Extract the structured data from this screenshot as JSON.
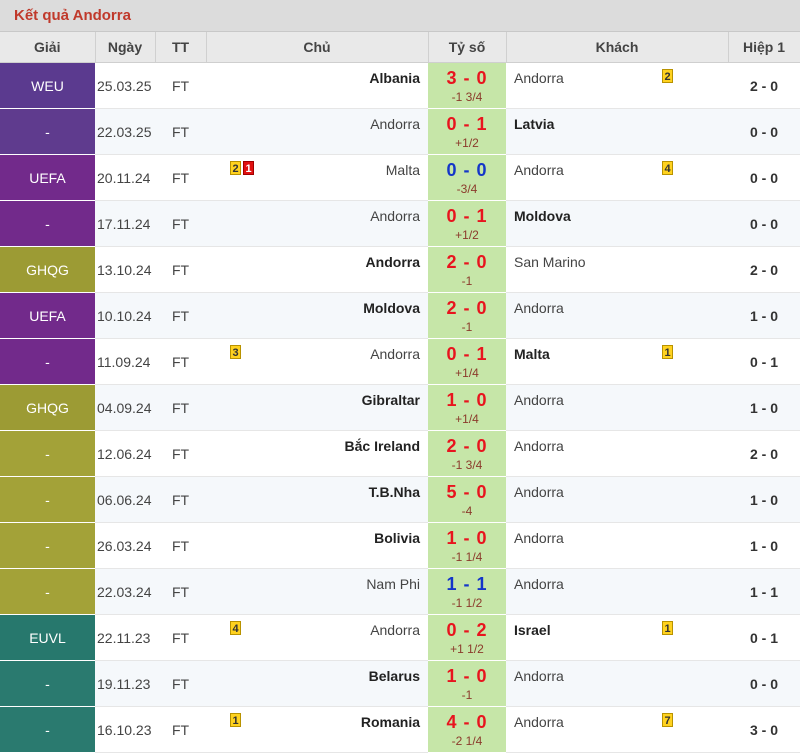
{
  "panel": {
    "title": "Kết quả Andorra"
  },
  "headers": {
    "league": "Giải",
    "date": "Ngày",
    "status": "TT",
    "home": "Chủ",
    "score": "Tỷ số",
    "away": "Khách",
    "ht": "Hiệp 1"
  },
  "league_colors": {
    "WEU": "#5b3a8f",
    "-purple": "#6a3a92",
    "UEFA": "#6f2b8a",
    "GHQG": "#9a9a2f",
    "-olive": "#a3a238",
    "EUVL": "#27786d"
  },
  "matches": [
    {
      "league": "WEU",
      "league_color": "#5b3a8f",
      "date": "25.03.25",
      "status": "FT",
      "home": "Albania",
      "home_bold": true,
      "home_cards": [],
      "score": "3 - 0",
      "score_type": "win",
      "handicap": "-1 3/4",
      "away": "Andorra",
      "away_bold": false,
      "away_cards": [
        {
          "n": "2",
          "c": "yellow"
        }
      ],
      "ht": "2 - 0"
    },
    {
      "league": "-",
      "league_color": "#5f3b8e",
      "date": "22.03.25",
      "status": "FT",
      "home": "Andorra",
      "home_bold": false,
      "home_cards": [],
      "score": "0 - 1",
      "score_type": "win",
      "handicap": "+1/2",
      "away": "Latvia",
      "away_bold": true,
      "away_cards": [],
      "ht": "0 - 0"
    },
    {
      "league": "UEFA",
      "league_color": "#722a8b",
      "date": "20.11.24",
      "status": "FT",
      "home": "Malta",
      "home_bold": false,
      "home_cards": [
        {
          "n": "2",
          "c": "yellow"
        },
        {
          "n": "1",
          "c": "red"
        }
      ],
      "score": "0 - 0",
      "score_type": "draw",
      "handicap": "-3/4",
      "away": "Andorra",
      "away_bold": false,
      "away_cards": [
        {
          "n": "4",
          "c": "yellow"
        }
      ],
      "ht": "0 - 0"
    },
    {
      "league": "-",
      "league_color": "#722a8b",
      "date": "17.11.24",
      "status": "FT",
      "home": "Andorra",
      "home_bold": false,
      "home_cards": [],
      "score": "0 - 1",
      "score_type": "win",
      "handicap": "+1/2",
      "away": "Moldova",
      "away_bold": true,
      "away_cards": [],
      "ht": "0 - 0"
    },
    {
      "league": "GHQG",
      "league_color": "#9c9b34",
      "date": "13.10.24",
      "status": "FT",
      "home": "Andorra",
      "home_bold": true,
      "home_cards": [],
      "score": "2 - 0",
      "score_type": "win",
      "handicap": "-1",
      "away": "San Marino",
      "away_bold": false,
      "away_cards": [],
      "ht": "2 - 0"
    },
    {
      "league": "UEFA",
      "league_color": "#722a8b",
      "date": "10.10.24",
      "status": "FT",
      "home": "Moldova",
      "home_bold": true,
      "home_cards": [],
      "score": "2 - 0",
      "score_type": "win",
      "handicap": "-1",
      "away": "Andorra",
      "away_bold": false,
      "away_cards": [],
      "ht": "1 - 0"
    },
    {
      "league": "-",
      "league_color": "#722a8b",
      "date": "11.09.24",
      "status": "FT",
      "home": "Andorra",
      "home_bold": false,
      "home_cards": [
        {
          "n": "3",
          "c": "yellow"
        }
      ],
      "score": "0 - 1",
      "score_type": "win",
      "handicap": "+1/4",
      "away": "Malta",
      "away_bold": true,
      "away_cards": [
        {
          "n": "1",
          "c": "yellow"
        }
      ],
      "ht": "0 - 1"
    },
    {
      "league": "GHQG",
      "league_color": "#9c9b34",
      "date": "04.09.24",
      "status": "FT",
      "home": "Gibraltar",
      "home_bold": true,
      "home_cards": [],
      "score": "1 - 0",
      "score_type": "win",
      "handicap": "+1/4",
      "away": "Andorra",
      "away_bold": false,
      "away_cards": [],
      "ht": "1 - 0"
    },
    {
      "league": "-",
      "league_color": "#a3a238",
      "date": "12.06.24",
      "status": "FT",
      "home": "Bắc Ireland",
      "home_bold": true,
      "home_cards": [],
      "score": "2 - 0",
      "score_type": "win",
      "handicap": "-1 3/4",
      "away": "Andorra",
      "away_bold": false,
      "away_cards": [],
      "ht": "2 - 0"
    },
    {
      "league": "-",
      "league_color": "#a3a238",
      "date": "06.06.24",
      "status": "FT",
      "home": "T.B.Nha",
      "home_bold": true,
      "home_cards": [],
      "score": "5 - 0",
      "score_type": "win",
      "handicap": "-4",
      "away": "Andorra",
      "away_bold": false,
      "away_cards": [],
      "ht": "1 - 0"
    },
    {
      "league": "-",
      "league_color": "#a3a238",
      "date": "26.03.24",
      "status": "FT",
      "home": "Bolivia",
      "home_bold": true,
      "home_cards": [],
      "score": "1 - 0",
      "score_type": "win",
      "handicap": "-1 1/4",
      "away": "Andorra",
      "away_bold": false,
      "away_cards": [],
      "ht": "1 - 0"
    },
    {
      "league": "-",
      "league_color": "#a3a238",
      "date": "22.03.24",
      "status": "FT",
      "home": "Nam Phi",
      "home_bold": false,
      "home_cards": [],
      "score": "1 - 1",
      "score_type": "draw",
      "handicap": "-1 1/2",
      "away": "Andorra",
      "away_bold": false,
      "away_cards": [],
      "ht": "1 - 1"
    },
    {
      "league": "EUVL",
      "league_color": "#27786d",
      "date": "22.11.23",
      "status": "FT",
      "home": "Andorra",
      "home_bold": false,
      "home_cards": [
        {
          "n": "4",
          "c": "yellow"
        }
      ],
      "score": "0 - 2",
      "score_type": "win",
      "handicap": "+1 1/2",
      "away": "Israel",
      "away_bold": true,
      "away_cards": [
        {
          "n": "1",
          "c": "yellow"
        }
      ],
      "ht": "0 - 1"
    },
    {
      "league": "-",
      "league_color": "#2a7a6f",
      "date": "19.11.23",
      "status": "FT",
      "home": "Belarus",
      "home_bold": true,
      "home_cards": [],
      "score": "1 - 0",
      "score_type": "win",
      "handicap": "-1",
      "away": "Andorra",
      "away_bold": false,
      "away_cards": [],
      "ht": "0 - 0"
    },
    {
      "league": "-",
      "league_color": "#2a7a6f",
      "date": "16.10.23",
      "status": "FT",
      "home": "Romania",
      "home_bold": true,
      "home_cards": [
        {
          "n": "1",
          "c": "yellow"
        }
      ],
      "score": "4 - 0",
      "score_type": "win",
      "handicap": "-2 1/4",
      "away": "Andorra",
      "away_bold": false,
      "away_cards": [
        {
          "n": "7",
          "c": "yellow"
        }
      ],
      "ht": "3 - 0"
    }
  ]
}
